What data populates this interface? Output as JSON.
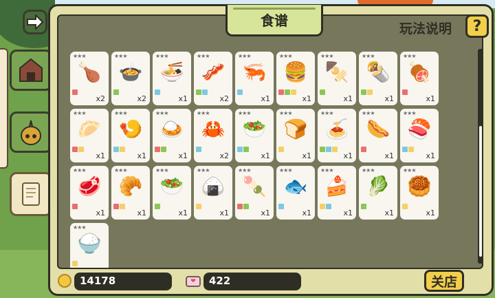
{
  "panel": {
    "title": "食谱",
    "help_label": "玩法说明",
    "help_button": "?"
  },
  "footer": {
    "coins": "14178",
    "hearts": "422",
    "close_label": "关店"
  },
  "colors": {
    "panel": "#e3dfa8",
    "inner": "#77775c",
    "accent": "#f2cf4a",
    "card": "#f8f6ef"
  },
  "tag_colors": {
    "r": "#e87070",
    "g": "#8bc657",
    "b": "#7fc8e4",
    "y": "#f5cf6a"
  },
  "recipes": [
    {
      "icon": "🍗",
      "stars": "★★★",
      "tags": [
        "r"
      ],
      "count": "x2"
    },
    {
      "icon": "🍲",
      "stars": "★★★",
      "tags": [
        "g"
      ],
      "count": "x2"
    },
    {
      "icon": "🍜",
      "stars": "★★★",
      "tags": [
        "b"
      ],
      "count": "x1"
    },
    {
      "icon": "🥓",
      "stars": "★★★",
      "tags": [
        "g",
        "b"
      ],
      "count": "x2"
    },
    {
      "icon": "🦐",
      "stars": "★★★",
      "tags": [
        "b"
      ],
      "count": "x1"
    },
    {
      "icon": "🍔",
      "stars": "★★★",
      "tags": [
        "r",
        "g",
        "y"
      ],
      "count": "x1"
    },
    {
      "icon": "🍢",
      "stars": "★★★",
      "tags": [
        "g"
      ],
      "count": "x1"
    },
    {
      "icon": "🌯",
      "stars": "★★★",
      "tags": [
        "g",
        "y"
      ],
      "count": "x1"
    },
    {
      "icon": "🍖",
      "stars": "★★★",
      "tags": [
        "r"
      ],
      "count": "x1"
    },
    {
      "icon": "🥟",
      "stars": "★★★",
      "tags": [
        "r",
        "y"
      ],
      "count": "x1"
    },
    {
      "icon": "🍤",
      "stars": "★★★",
      "tags": [
        "b",
        "y"
      ],
      "count": "x1"
    },
    {
      "icon": "🍛",
      "stars": "★★★",
      "tags": [
        "r",
        "g"
      ],
      "count": "x1"
    },
    {
      "icon": "🦀",
      "stars": "★★★",
      "tags": [
        "b"
      ],
      "count": "x2"
    },
    {
      "icon": "🥗",
      "stars": "★★★",
      "tags": [
        "b",
        "g"
      ],
      "count": "x1"
    },
    {
      "icon": "🍞",
      "stars": "★★★",
      "tags": [
        "y"
      ],
      "count": "x1"
    },
    {
      "icon": "🍝",
      "stars": "★★★",
      "tags": [
        "g",
        "b",
        "y"
      ],
      "count": "x1"
    },
    {
      "icon": "🌭",
      "stars": "★★★",
      "tags": [
        "r"
      ],
      "count": "x1"
    },
    {
      "icon": "🍣",
      "stars": "★★★",
      "tags": [
        "b",
        "y"
      ],
      "count": "x1"
    },
    {
      "icon": "🥩",
      "stars": "★★★",
      "tags": [
        "r"
      ],
      "count": "x1"
    },
    {
      "icon": "🥐",
      "stars": "★★★",
      "tags": [
        "r",
        "y"
      ],
      "count": "x1"
    },
    {
      "icon": "🥗",
      "stars": "★★★",
      "tags": [
        "g"
      ],
      "count": "x1"
    },
    {
      "icon": "🍙",
      "stars": "★★★",
      "tags": [
        "y"
      ],
      "count": "x1"
    },
    {
      "icon": "🍡",
      "stars": "★★★",
      "tags": [
        "r",
        "g"
      ],
      "count": "x1"
    },
    {
      "icon": "🐟",
      "stars": "★★★",
      "tags": [
        "b"
      ],
      "count": "x1"
    },
    {
      "icon": "🍰",
      "stars": "★★★",
      "tags": [
        "y",
        "b"
      ],
      "count": "x1"
    },
    {
      "icon": "🥬",
      "stars": "★★★",
      "tags": [
        "g"
      ],
      "count": "x1"
    },
    {
      "icon": "🥮",
      "stars": "★★★",
      "tags": [
        "y"
      ],
      "count": "x1"
    },
    {
      "icon": "🍚",
      "stars": "★★★",
      "tags": [
        "y"
      ],
      "count": ""
    }
  ]
}
